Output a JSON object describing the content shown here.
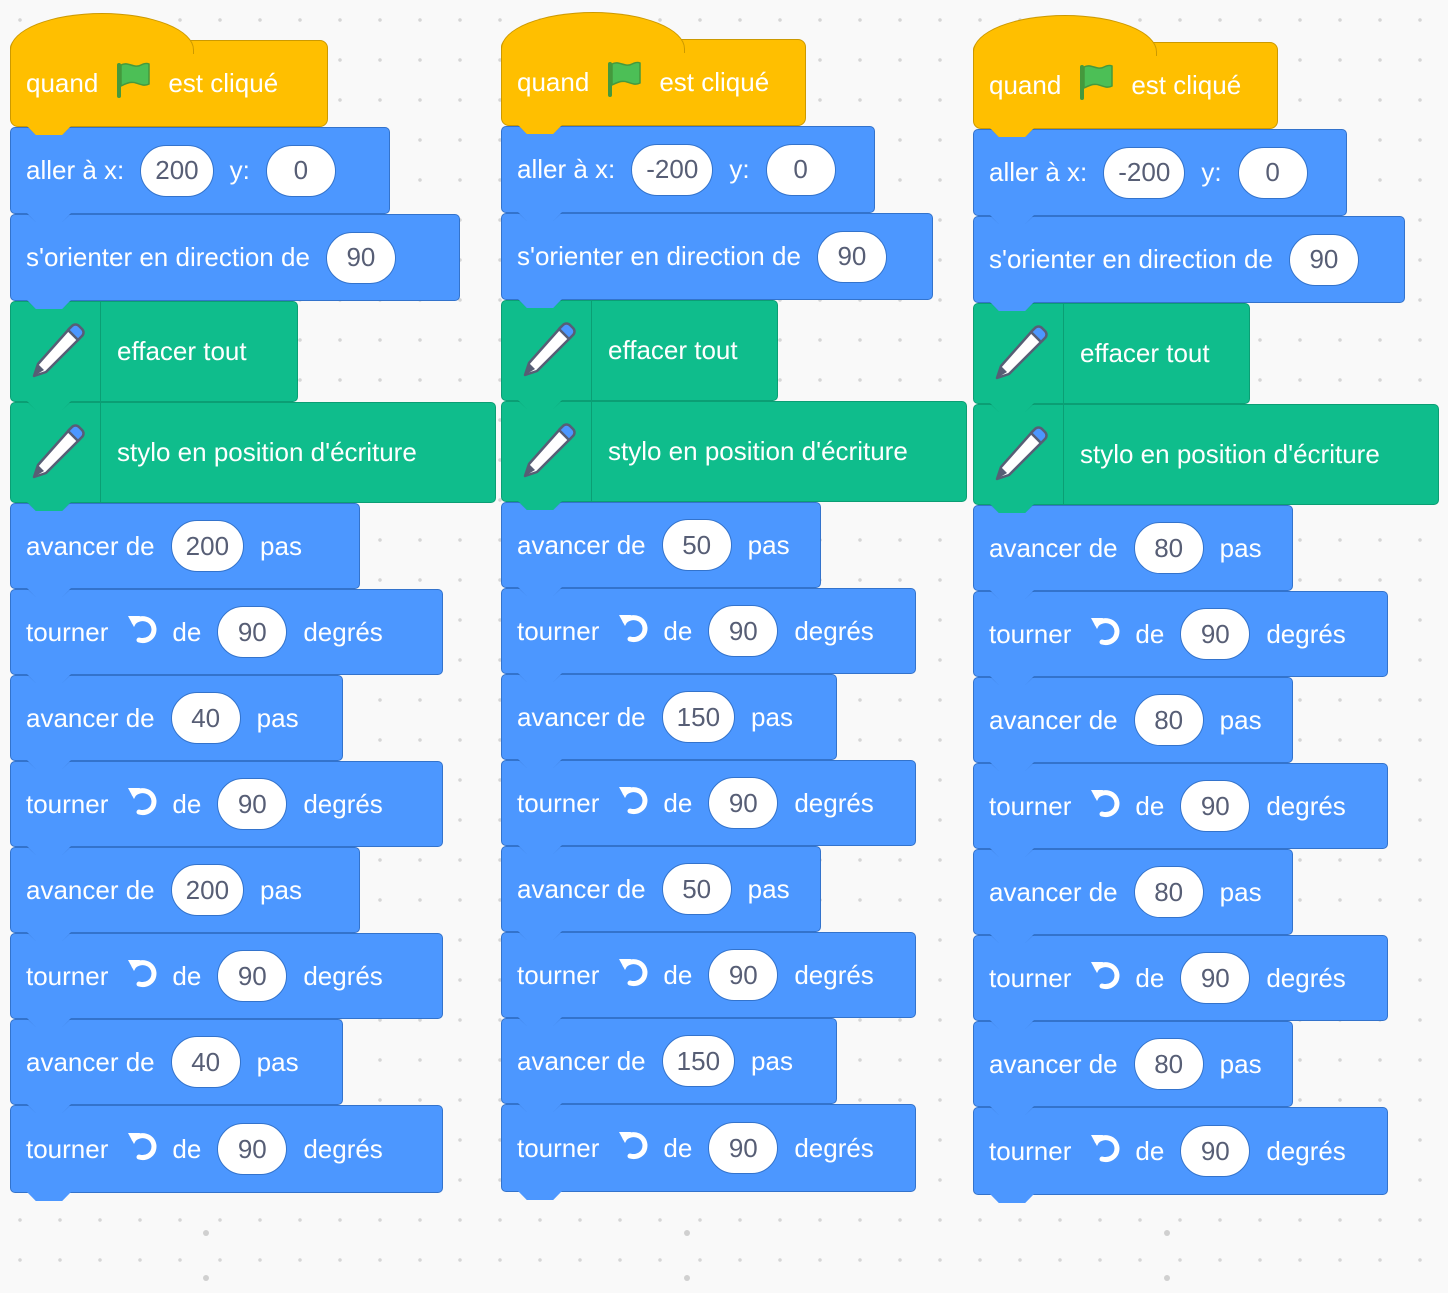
{
  "colors": {
    "motion": "#4c97ff",
    "pen": "#0fbd8c",
    "event": "#ffbf00",
    "workspace": "#f9f9f9",
    "flag": "#4cbf56"
  },
  "icons": [
    "green-flag-icon",
    "pen-icon",
    "turn-left-icon"
  ],
  "scripts": [
    {
      "hat": {
        "prefix": "quand",
        "suffix": "est cliqué"
      },
      "goto": {
        "label": "aller à x:",
        "x": "200",
        "ylabel": "y:",
        "y": "0"
      },
      "point": {
        "label": "s'orienter en direction de",
        "value": "90"
      },
      "clear": {
        "label": "effacer tout"
      },
      "pendown": {
        "label": "stylo en position d'écriture"
      },
      "moves": [
        {
          "kind": "move",
          "prefix": "avancer de",
          "value": "200",
          "suffix": "pas"
        },
        {
          "kind": "turn",
          "prefix": "tourner",
          "mid": "de",
          "value": "90",
          "suffix": "degrés"
        },
        {
          "kind": "move",
          "prefix": "avancer de",
          "value": "40",
          "suffix": "pas"
        },
        {
          "kind": "turn",
          "prefix": "tourner",
          "mid": "de",
          "value": "90",
          "suffix": "degrés"
        },
        {
          "kind": "move",
          "prefix": "avancer de",
          "value": "200",
          "suffix": "pas"
        },
        {
          "kind": "turn",
          "prefix": "tourner",
          "mid": "de",
          "value": "90",
          "suffix": "degrés"
        },
        {
          "kind": "move",
          "prefix": "avancer de",
          "value": "40",
          "suffix": "pas"
        },
        {
          "kind": "turn",
          "prefix": "tourner",
          "mid": "de",
          "value": "90",
          "suffix": "degrés"
        }
      ]
    },
    {
      "hat": {
        "prefix": "quand",
        "suffix": "est cliqué"
      },
      "goto": {
        "label": "aller à x:",
        "x": "-200",
        "ylabel": "y:",
        "y": "0"
      },
      "point": {
        "label": "s'orienter en direction de",
        "value": "90"
      },
      "clear": {
        "label": "effacer tout"
      },
      "pendown": {
        "label": "stylo en position d'écriture"
      },
      "moves": [
        {
          "kind": "move",
          "prefix": "avancer de",
          "value": "50",
          "suffix": "pas"
        },
        {
          "kind": "turn",
          "prefix": "tourner",
          "mid": "de",
          "value": "90",
          "suffix": "degrés"
        },
        {
          "kind": "move",
          "prefix": "avancer de",
          "value": "150",
          "suffix": "pas"
        },
        {
          "kind": "turn",
          "prefix": "tourner",
          "mid": "de",
          "value": "90",
          "suffix": "degrés"
        },
        {
          "kind": "move",
          "prefix": "avancer de",
          "value": "50",
          "suffix": "pas"
        },
        {
          "kind": "turn",
          "prefix": "tourner",
          "mid": "de",
          "value": "90",
          "suffix": "degrés"
        },
        {
          "kind": "move",
          "prefix": "avancer de",
          "value": "150",
          "suffix": "pas"
        },
        {
          "kind": "turn",
          "prefix": "tourner",
          "mid": "de",
          "value": "90",
          "suffix": "degrés"
        }
      ]
    },
    {
      "hat": {
        "prefix": "quand",
        "suffix": "est cliqué"
      },
      "goto": {
        "label": "aller à x:",
        "x": "-200",
        "ylabel": "y:",
        "y": "0"
      },
      "point": {
        "label": "s'orienter en direction de",
        "value": "90"
      },
      "clear": {
        "label": "effacer tout"
      },
      "pendown": {
        "label": "stylo en position d'écriture"
      },
      "moves": [
        {
          "kind": "move",
          "prefix": "avancer de",
          "value": "80",
          "suffix": "pas"
        },
        {
          "kind": "turn",
          "prefix": "tourner",
          "mid": "de",
          "value": "90",
          "suffix": "degrés"
        },
        {
          "kind": "move",
          "prefix": "avancer de",
          "value": "80",
          "suffix": "pas"
        },
        {
          "kind": "turn",
          "prefix": "tourner",
          "mid": "de",
          "value": "90",
          "suffix": "degrés"
        },
        {
          "kind": "move",
          "prefix": "avancer de",
          "value": "80",
          "suffix": "pas"
        },
        {
          "kind": "turn",
          "prefix": "tourner",
          "mid": "de",
          "value": "90",
          "suffix": "degrés"
        },
        {
          "kind": "move",
          "prefix": "avancer de",
          "value": "80",
          "suffix": "pas"
        },
        {
          "kind": "turn",
          "prefix": "tourner",
          "mid": "de",
          "value": "90",
          "suffix": "degrés"
        }
      ]
    }
  ]
}
